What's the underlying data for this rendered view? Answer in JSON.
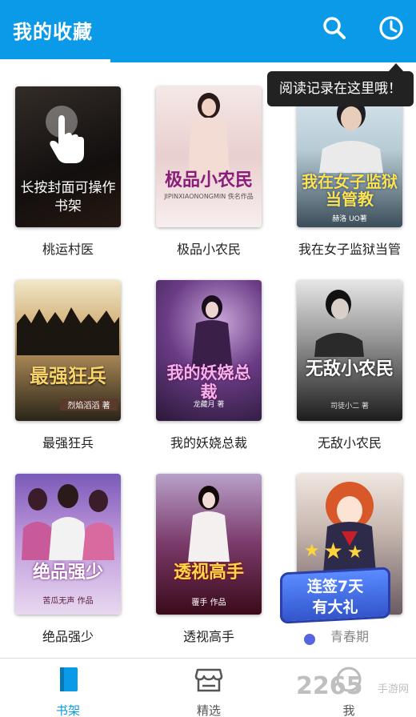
{
  "header": {
    "title": "我的收藏",
    "search_icon": "search-icon",
    "history_icon": "clock-icon"
  },
  "colors": {
    "accent": "#0a9ae8",
    "tooltip_bg": "#222222"
  },
  "tooltip": {
    "text": "阅读记录在这里哦！"
  },
  "hint": {
    "text": "长按封面可操作书架"
  },
  "books": [
    {
      "title": "桃运村医",
      "cover_text": ""
    },
    {
      "title": "极品小农民",
      "cover_text": "极品小农民",
      "cover_sub": "JIPINXIAONONGMIN 佚名作品"
    },
    {
      "title": "我在女子监狱当管",
      "cover_text": "我在女子监狱当管教",
      "cover_sub": "赫洛 UO著"
    },
    {
      "title": "最强狂兵",
      "cover_text": "最强狂兵",
      "cover_sub": "烈焰滔滔 著"
    },
    {
      "title": "我的妖娆总裁",
      "cover_text": "我的妖娆总裁",
      "cover_sub": "龙藏月 著"
    },
    {
      "title": "无敌小农民",
      "cover_text": "无敌小农民",
      "cover_sub": "司徒小二 著"
    },
    {
      "title": "绝品强少",
      "cover_text": "绝品强少",
      "cover_sub": "苦瓜无声 作品"
    },
    {
      "title": "透视高手",
      "cover_text": "透视高手",
      "cover_sub": "覆手 作品"
    },
    {
      "title": "青春期",
      "cover_text": "",
      "cover_sub": ""
    }
  ],
  "promo": {
    "line1": "连签7天",
    "line2": "有大礼"
  },
  "nav": [
    {
      "label": "书架",
      "icon": "book-icon",
      "active": true
    },
    {
      "label": "精选",
      "icon": "store-icon",
      "active": false
    },
    {
      "label": "我",
      "icon": "user-icon",
      "active": false
    }
  ],
  "watermark": {
    "logo": "2265",
    "sub": "手游网"
  }
}
